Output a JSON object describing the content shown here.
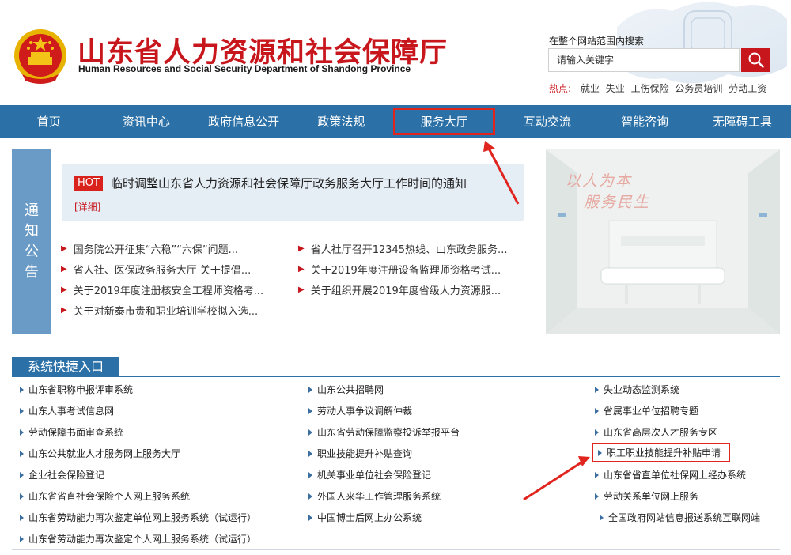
{
  "header": {
    "title_cn": "山东省人力资源和社会保障厅",
    "title_en": "Human Resources and Social Security Department of Shandong Province",
    "search_label": "在整个网站范围内搜索",
    "search_placeholder": "请输入关键字",
    "hot_label": "热点:",
    "hot_words": [
      "就业",
      "失业",
      "工伤保险",
      "公务员培训",
      "劳动工资"
    ]
  },
  "nav": {
    "items": [
      "首页",
      "资讯中心",
      "政府信息公开",
      "政策法规",
      "服务大厅",
      "互动交流",
      "智能咨询",
      "无障碍工具"
    ],
    "highlighted": "服务大厅"
  },
  "notice": {
    "side_label": [
      "通",
      "知",
      "公",
      "告"
    ],
    "hot_badge": "HOT",
    "hot_title": "临时调整山东省人力资源和社会保障厅政务服务大厅工作时间的通知",
    "hot_more": "[详细]",
    "items": [
      "国务院公开征集“六稳”“六保”问题...",
      "省人社厅召开12345热线、山东政务服务...",
      "省人社、医保政务服务大厅 关于提倡...",
      "关于2019年度注册设备监理师资格考试...",
      "关于2019年度注册核安全工程师资格考...",
      "关于组织开展2019年度省级人力资源服...",
      "关于对新泰市贵和职业培训学校拟入选..."
    ]
  },
  "banner": {
    "line1": "以人为本",
    "line2": "服务民生"
  },
  "quick": {
    "title": "系统快捷入口",
    "col1": [
      "山东省职称申报评审系统",
      "山东人事考试信息网",
      "劳动保障书面审查系统",
      "山东公共就业人才服务网上服务大厅",
      "企业社会保险登记",
      "山东省省直社会保险个人网上服务系统",
      "山东省劳动能力再次鉴定单位网上服务系统（试运行）",
      "山东省劳动能力再次鉴定个人网上服务系统（试运行）"
    ],
    "col2": [
      "山东公共招聘网",
      "劳动人事争议调解仲裁",
      "山东省劳动保障监察投诉举报平台",
      "职业技能提升补贴查询",
      "机关事业单位社会保险登记",
      "外国人来华工作管理服务系统",
      "中国博士后网上办公系统"
    ],
    "col3": [
      "失业动态监测系统",
      "省属事业单位招聘专题",
      "山东省高层次人才服务专区",
      "职工职业技能提升补贴申请",
      "山东省省直单位社保网上经办系统",
      "劳动关系单位网上服务",
      "全国政府网站信息报送系统互联网端"
    ],
    "highlighted": "职工职业技能提升补贴申请"
  },
  "colors": {
    "brand_red": "#c8161d",
    "nav_blue": "#2b70a6",
    "annotation_red": "#e0251f"
  }
}
